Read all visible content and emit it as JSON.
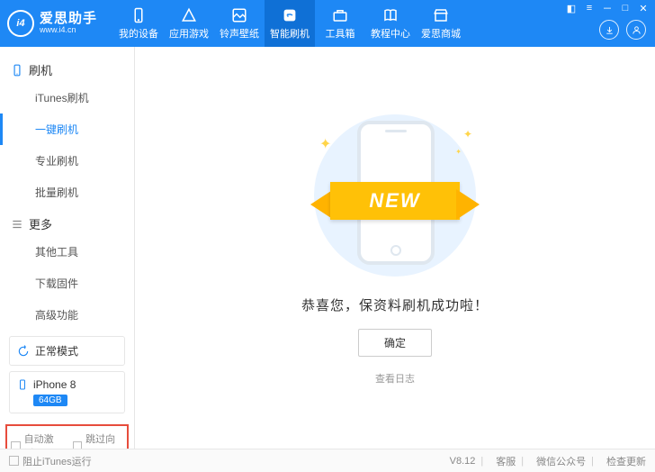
{
  "app": {
    "name": "爱思助手",
    "url": "www.i4.cn",
    "logo_badge": "i4"
  },
  "nav": {
    "items": [
      {
        "label": "我的设备"
      },
      {
        "label": "应用游戏"
      },
      {
        "label": "铃声壁纸"
      },
      {
        "label": "智能刷机"
      },
      {
        "label": "工具箱"
      },
      {
        "label": "教程中心"
      },
      {
        "label": "爱思商城"
      }
    ],
    "active_index": 3
  },
  "sidebar": {
    "cat1_label": "刷机",
    "cat1_items": [
      {
        "label": "iTunes刷机"
      },
      {
        "label": "一键刷机"
      },
      {
        "label": "专业刷机"
      },
      {
        "label": "批量刷机"
      }
    ],
    "cat1_active_index": 1,
    "cat2_label": "更多",
    "cat2_items": [
      {
        "label": "其他工具"
      },
      {
        "label": "下载固件"
      },
      {
        "label": "高级功能"
      }
    ],
    "status_label": "正常模式",
    "device": {
      "name": "iPhone 8",
      "storage": "64GB"
    },
    "check1_label": "自动激活",
    "check2_label": "跳过向导"
  },
  "content": {
    "ribbon_text": "NEW",
    "success_message": "恭喜您，保资料刷机成功啦！",
    "confirm_button": "确定",
    "view_log": "查看日志"
  },
  "footer": {
    "block_itunes": "阻止iTunes运行",
    "version": "V8.12",
    "support": "客服",
    "wechat": "微信公众号",
    "update": "检查更新"
  }
}
